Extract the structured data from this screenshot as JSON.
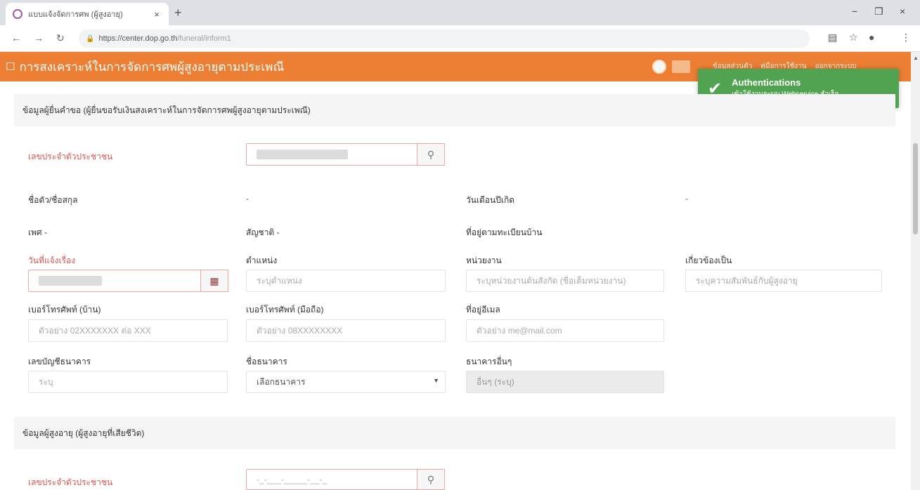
{
  "browser": {
    "tab_title": "แบบแจ้งจัดการศพ (ผู้สูงอายุ)",
    "tab_close": "×",
    "new_tab": "+",
    "url_host": "https://center.dop.go.th",
    "url_path": "/funeral/inform1",
    "minimize": "−",
    "restore": "❐",
    "close": "×"
  },
  "header": {
    "title": "การสงเคราะห์ในการจัดการศพผู้สูงอายุตามประเพณี",
    "menu": [
      "ข้อมูลส่วนตัว",
      "คู่มือการใช้งาน",
      "ออกจากระบบ"
    ]
  },
  "toast": {
    "title": "Authentications",
    "message": "เข้าใช้งานระบบ Webservice สำเร็จ"
  },
  "section1": {
    "title": "ข้อมูลผู้ยื่นคำขอ (ผู้ยื่นขอรับเงินสงเคราะห์ในการจัดการศพผู้สูงอายุตามประเพณี)",
    "citizen_id_label": "เลขประจำตัวประชาชน",
    "name_label": "ชื่อตัว/ชื่อสกุล",
    "name_value": "-",
    "birthdate_label": "วันเดือนปีเกิด",
    "birthdate_value": "-",
    "gender_label": "เพศ -",
    "nationality_label": "สัญชาติ -",
    "address_label": "ที่อยู่ตามทะเบียนบ้าน",
    "contact_date_label": "วันที่แจ้งเรื่อง",
    "position_label": "ตำแหน่ง",
    "position_placeholder": "ระบุตำแหน่ง",
    "agency_label": "หน่วยงาน",
    "agency_placeholder": "ระบุหน่วยงานต้นสังกัด (ชื่อเต็มหน่วยงาน)",
    "relation_label": "เกี่ยวข้องเป็น",
    "relation_placeholder": "ระบุความสัมพันธ์กับผู้สูงอายุ",
    "home_phone_label": "เบอร์โทรศัพท์ (บ้าน)",
    "home_phone_placeholder": "ตัวอย่าง 02XXXXXXX ต่อ XXX",
    "mobile_label": "เบอร์โทรศัพท์ (มือถือ)",
    "mobile_placeholder": "ตัวอย่าง 08XXXXXXXX",
    "email_label": "ที่อยู่อีเมล",
    "email_placeholder": "ตัวอย่าง me@mail.com",
    "bank_account_label": "เลขบัญชีธนาคาร",
    "bank_account_placeholder": "ระบุ",
    "bank_name_label": "ชื่อธนาคาร",
    "bank_name_selected": "เลือกธนาคาร",
    "other_bank_label": "ธนาคารอื่นๆ",
    "other_bank_value": "อื่นๆ (ระบุ)"
  },
  "section2": {
    "title": "ข้อมูลผู้สูงอายุ (ผู้สูงอายุที่เสียชีวิต)",
    "citizen_id_label": "เลขประจำตัวประชาชน",
    "citizen_id_placeholder": "-_-___-_____-__-_"
  },
  "icons": {
    "search": "🔍",
    "calendar": "▦",
    "check": "✔",
    "caret": "▼"
  }
}
